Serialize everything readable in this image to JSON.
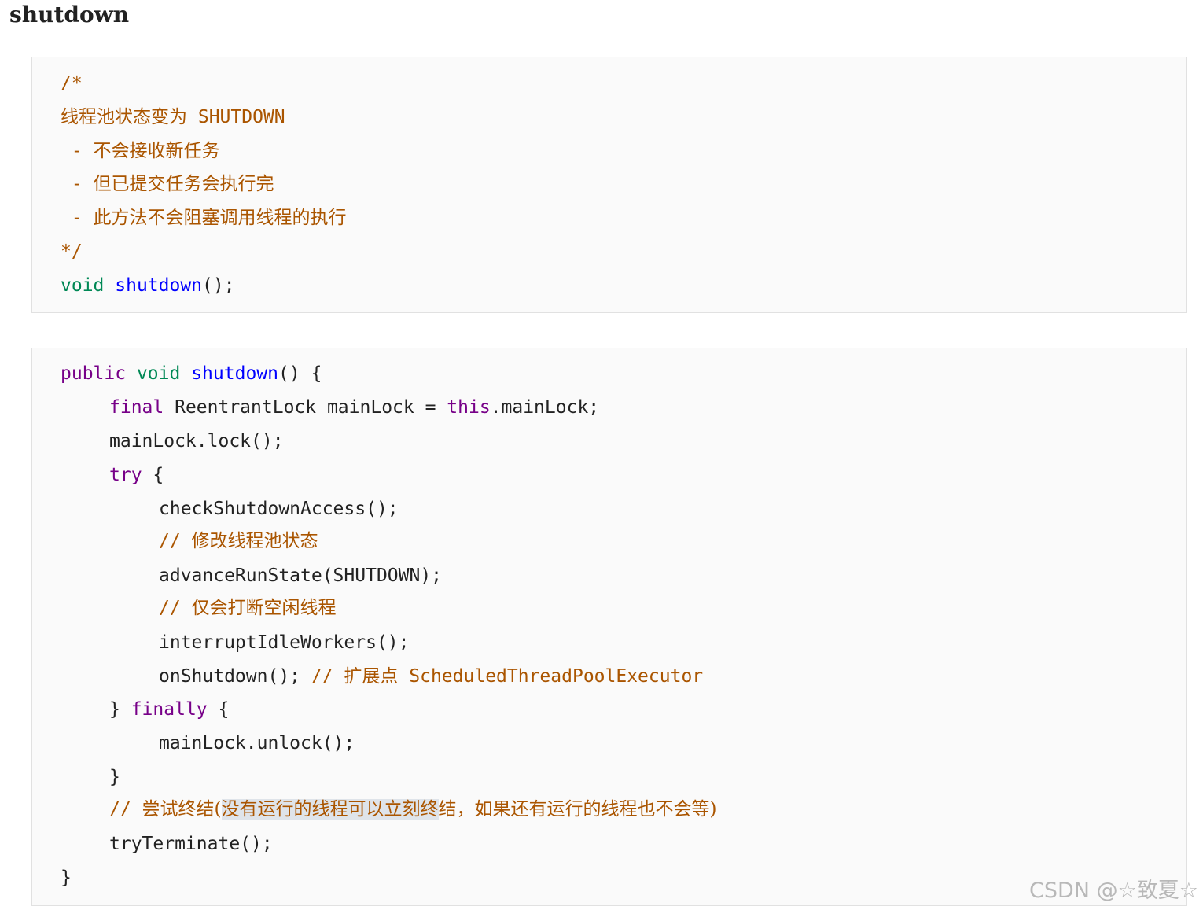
{
  "heading": "shutdown",
  "block1": {
    "comment_open": "/*",
    "line1_cn": "线程池状态变为",
    "line1_code": " SHUTDOWN",
    "bullet_dash": " - ",
    "bullet1": "不会接收新任务",
    "bullet2": "但已提交任务会执行完",
    "bullet3": "此方法不会阻塞调用线程的执行",
    "comment_close": "*/",
    "sig_type": "void",
    "sig_name": "shutdown",
    "sig_end": "();"
  },
  "block2": {
    "l1_public": "public",
    "l1_void": "void",
    "l1_name": "shutdown",
    "l1_end": "() {",
    "l2_final": "final",
    "l2_mid": " ReentrantLock mainLock = ",
    "l2_this": "this",
    "l2_end": ".mainLock;",
    "l3": "mainLock.lock();",
    "l4_try": "try",
    "l4_end": " {",
    "l5": "checkShutdownAccess();",
    "l6_slash": "// ",
    "l6_cn": "修改线程池状态",
    "l7": "advanceRunState(SHUTDOWN);",
    "l8_slash": "// ",
    "l8_cn": "仅会打断空闲线程",
    "l9": "interruptIdleWorkers();",
    "l10_code": "onShutdown(); ",
    "l10_slash": "// ",
    "l10_cn": "扩展点",
    "l10_tail": " ScheduledThreadPoolExecutor",
    "l11_open": "} ",
    "l11_finally": "finally",
    "l11_end": " {",
    "l12": "mainLock.unlock();",
    "l13": "}",
    "l14_slash": "// ",
    "l14_cn_a": "尝试终结(",
    "l14_cn_hl": "没有运行的线程可以立刻终",
    "l14_cn_b": "结，如果还有运行的线程也不会等)",
    "l15": "tryTerminate();",
    "l16": "}"
  },
  "watermark": "CSDN @☆致夏☆"
}
